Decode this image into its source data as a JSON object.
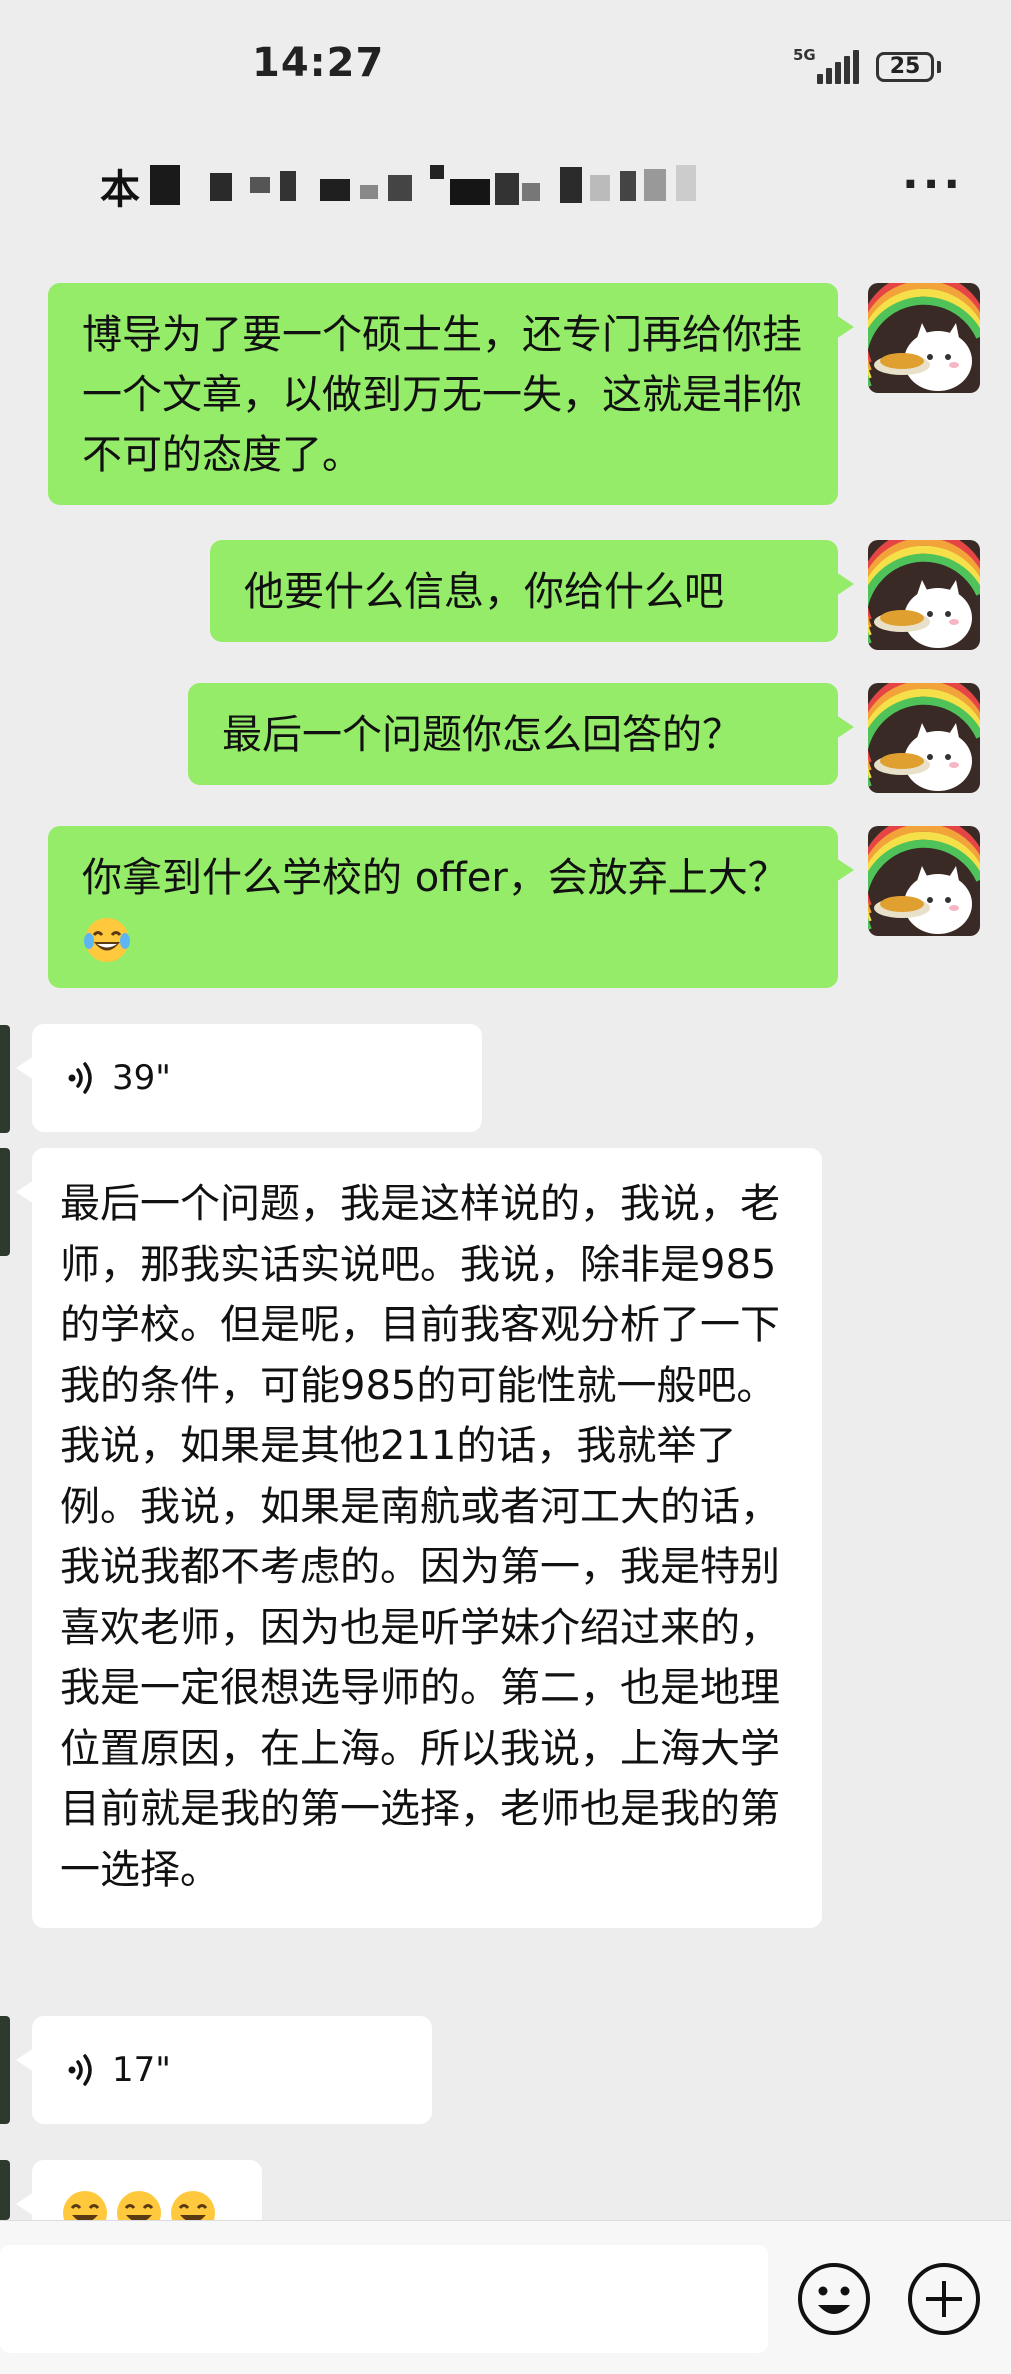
{
  "status_bar": {
    "time": "14:27",
    "network": "5G",
    "battery": "25"
  },
  "header": {
    "title_visible": "本",
    "more_icon": "more-horizontal-icon"
  },
  "messages": [
    {
      "id": "m1",
      "side": "me",
      "text": "博导为了要一个硕士生，还专门再给你挂一个文章，以做到万无一失，这就是非你不可的态度了。"
    },
    {
      "id": "m2",
      "side": "me",
      "text": "他要什么信息，你给什么吧"
    },
    {
      "id": "m3",
      "side": "me",
      "text": "最后一个问题你怎么回答的？"
    },
    {
      "id": "m4",
      "side": "me",
      "text": "你拿到什么学校的 offer，会放弃上大？",
      "emoji": "laughing-tears-emoji"
    },
    {
      "id": "m5",
      "side": "other",
      "type": "voice",
      "duration": "39\""
    },
    {
      "id": "m6",
      "side": "other",
      "text": "最后一个问题，我是这样说的，我说，老师，那我实话实说吧。我说，除非是985的学校。但是呢，目前我客观分析了一下我的条件，可能985的可能性就一般吧。我说，如果是其他211的话，我就举了例。我说，如果是南航或者河工大的话，我说我都不考虑的。因为第一，我是特别喜欢老师，因为也是听学妹介绍过来的，我是一定很想选导师的。第二，也是地理位置原因，在上海。所以我说，上海大学目前就是我的第一选择，老师也是我的第一选择。"
    },
    {
      "id": "m7",
      "side": "other",
      "type": "voice",
      "duration": "17\""
    },
    {
      "id": "m8",
      "side": "other",
      "type": "emoji",
      "emoji": "grinning-emoji-x3"
    }
  ],
  "input_bar": {
    "value": "",
    "emoji_button_icon": "smiley-icon",
    "plus_button_icon": "plus-circle-icon"
  },
  "colors": {
    "background": "#ededed",
    "my_bubble": "#95ec69",
    "their_bubble": "#ffffff"
  }
}
